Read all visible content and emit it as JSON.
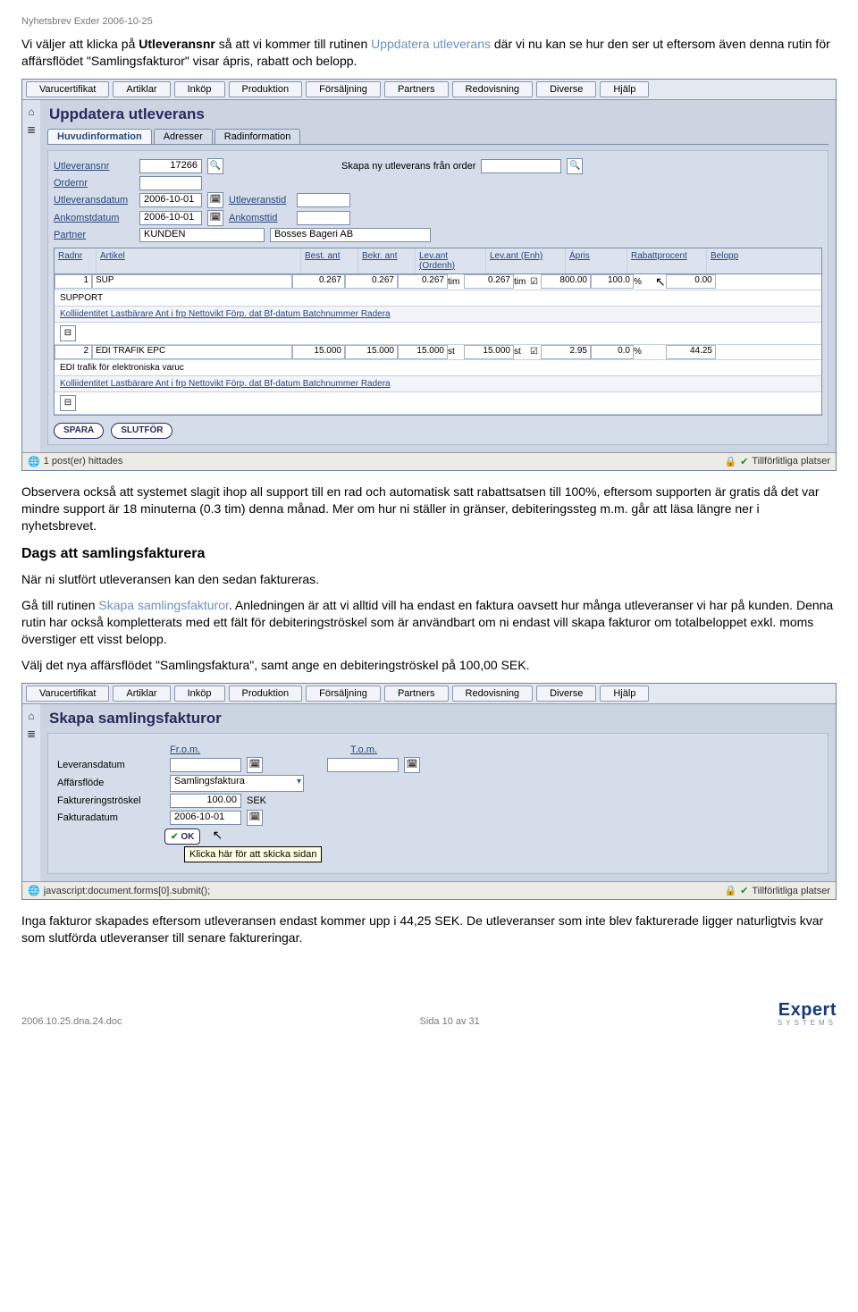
{
  "doc": {
    "header": "Nyhetsbrev Exder 2006-10-25",
    "p1a": "Vi väljer att klicka på ",
    "p1b": "Utleveransnr",
    "p1c": " så att vi kommer till rutinen ",
    "p1d": "Uppdatera utleverans",
    "p1e": " där vi nu kan se hur den ser ut eftersom även denna rutin för affärsflödet \"Samlingsfakturor\" visar ápris, rabatt och belopp.",
    "p2": "Observera också att systemet slagit ihop all support till en rad och automatisk satt rabattsatsen till 100%, eftersom supporten är gratis då det var mindre support är 18 minuterna (0.3 tim) denna månad. Mer om hur ni ställer in gränser, debiteringssteg m.m. går att läsa längre ner i nyhetsbrevet.",
    "h2": "Dags att samlingsfakturera",
    "p3": "När ni slutfört utleveransen kan den sedan faktureras.",
    "p4a": "Gå till rutinen ",
    "p4b": "Skapa samlingsfakturor",
    "p4c": ". Anledningen är att vi alltid vill ha endast en faktura oavsett hur många utleveranser vi har på kunden. Denna rutin har också kompletterats med ett fält för debiteringströskel som är användbart om ni endast vill skapa fakturor om totalbeloppet exkl. moms överstiger ett visst belopp.",
    "p5": "Välj det nya affärsflödet \"Samlingsfaktura\", samt ange en debiteringströskel på 100,00 SEK.",
    "p6": "Inga fakturor skapades eftersom utleveransen endast kommer upp i 44,25 SEK. De utleveranser som inte blev fakturerade ligger naturligtvis kvar som slutförda utleveranser till senare faktureringar."
  },
  "menus": [
    "Varucertifikat",
    "Artiklar",
    "Inköp",
    "Produktion",
    "Försäljning",
    "Partners",
    "Redovisning",
    "Diverse",
    "Hjälp"
  ],
  "win1": {
    "title": "Uppdatera utleverans",
    "tabs": [
      "Huvudinformation",
      "Adresser",
      "Radinformation"
    ],
    "fields": {
      "utleveransnr_lbl": "Utleveransnr",
      "utleveransnr": "17266",
      "skapa_lbl": "Skapa ny utleverans från order",
      "ordernr_lbl": "Ordernr",
      "utlevdatum_lbl": "Utleveransdatum",
      "utlevdatum": "2006-10-01",
      "utlevtid_lbl": "Utleveranstid",
      "ankdatum_lbl": "Ankomstdatum",
      "ankdatum": "2006-10-01",
      "anktid_lbl": "Ankomsttid",
      "partner_lbl": "Partner",
      "partner1": "KUNDEN",
      "partner2": "Bosses Bageri AB"
    },
    "cols": [
      "Radnr",
      "Artikel",
      "Best. ant",
      "Bekr. ant",
      "Lev.ant (Ordenh)",
      "Lev.ant (Enh)",
      "Ápris",
      "Rabattprocent",
      "Belopp"
    ],
    "rows": [
      {
        "nr": "1",
        "art": "SUP",
        "desc": "SUPPORT",
        "best": "0.267",
        "bekr": "0.267",
        "levo": "0.267",
        "levou": "tim",
        "leve": "0.267",
        "leveu": "tim",
        "pris": "800.00",
        "rab": "100.0",
        "rabu": "%",
        "bel": "0.00"
      },
      {
        "nr": "2",
        "art": "EDI TRAFIK EPC",
        "desc": "EDI trafik för elektroniska varuc",
        "best": "15.000",
        "bekr": "15.000",
        "levo": "15.000",
        "levou": "st",
        "leve": "15.000",
        "leveu": "st",
        "pris": "2.95",
        "rab": "0.0",
        "rabu": "%",
        "bel": "44.25"
      }
    ],
    "subline": "Kolliidentitet Lastbärare Ant i frp Nettovikt Förp. dat Bf-datum Batchnummer Radera",
    "btns": [
      "SPARA",
      "SLUTFÖR"
    ],
    "status_left": "1 post(er) hittades",
    "status_right": "Tillförlitliga platser"
  },
  "win2": {
    "title": "Skapa samlingsfakturor",
    "labels": {
      "from": "Fr.o.m.",
      "tom": "T.o.m.",
      "leverans": "Leveransdatum",
      "flow": "Affärsflöde",
      "flow_val": "Samlingsfaktura",
      "troskel": "Faktureringströskel",
      "troskel_val": "100.00",
      "troskel_unit": "SEK",
      "fdatum": "Fakturadatum",
      "fdatum_val": "2006-10-01",
      "ok": "OK",
      "tooltip": "Klicka här för att skicka sidan"
    },
    "status_left": "javascript:document.forms[0].submit();",
    "status_right": "Tillförlitliga platser"
  },
  "footer": {
    "left": "2006.10.25.dna.24.doc",
    "mid": "Sida 10 av 31",
    "logo1": "Expert",
    "logo2": "SYSTEMS"
  }
}
